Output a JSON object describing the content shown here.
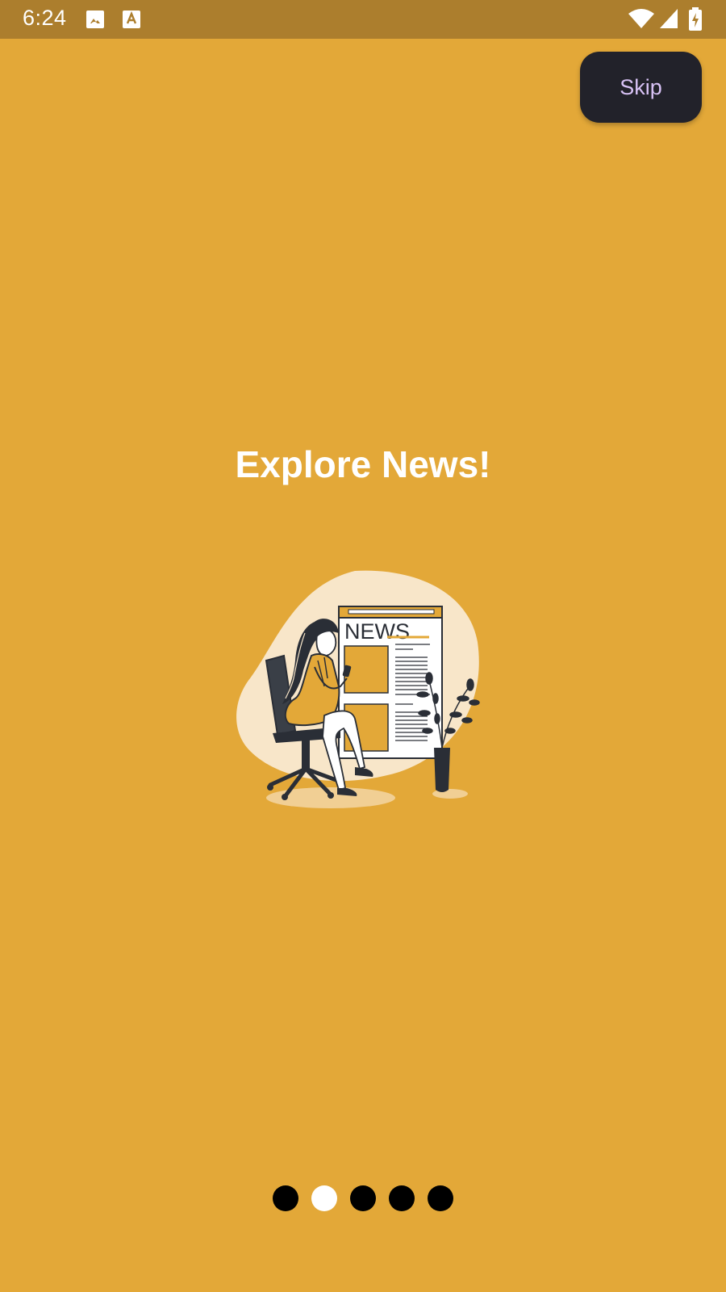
{
  "status_bar": {
    "time": "6:24",
    "notification_icons": [
      "image-notification-icon",
      "text-a-notification-icon"
    ],
    "system_icons": [
      "wifi-icon",
      "cell-signal-icon",
      "battery-charging-icon"
    ]
  },
  "skip_label": "Skip",
  "headline": "Explore News!",
  "illustration": {
    "name": "woman-reading-news-illustration",
    "newspaper_text": "NEWS"
  },
  "pager": {
    "count": 5,
    "active_index": 1
  },
  "colors": {
    "background": "#E3A838",
    "status_bar": "#AC7E2D",
    "skip_button": "#22222A",
    "skip_text": "#D8C2F5",
    "dot": "#000000",
    "dot_active": "#FFFFFF"
  }
}
